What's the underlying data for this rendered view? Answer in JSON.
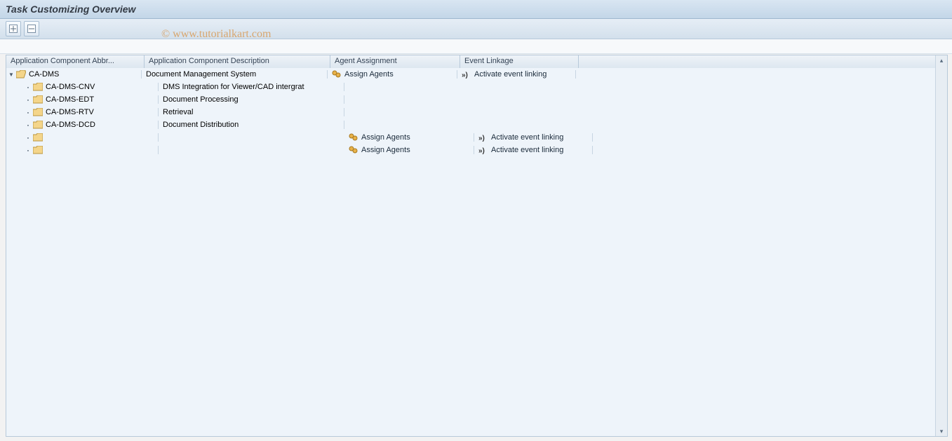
{
  "header": {
    "title": "Task Customizing Overview"
  },
  "watermark": "© www.tutorialkart.com",
  "toolbar": {
    "expand_all": "expand-all",
    "collapse_all": "collapse-all"
  },
  "columns": {
    "abbr": "Application Component Abbr...",
    "desc": "Application Component Description",
    "agent": "Agent Assignment",
    "event": "Event Linkage"
  },
  "tree": [
    {
      "level": 0,
      "expanded": true,
      "folder": "open",
      "abbr": "CA-DMS",
      "desc": "Document Management System",
      "agent": "Assign Agents",
      "event": "Activate event linking"
    },
    {
      "level": 1,
      "folder": "closed",
      "abbr": "CA-DMS-CNV",
      "desc": "DMS Integration for Viewer/CAD intergrat",
      "agent": "",
      "event": ""
    },
    {
      "level": 1,
      "folder": "closed",
      "abbr": "CA-DMS-EDT",
      "desc": "Document Processing",
      "agent": "",
      "event": ""
    },
    {
      "level": 1,
      "folder": "closed",
      "abbr": "CA-DMS-RTV",
      "desc": "Retrieval",
      "agent": "",
      "event": ""
    },
    {
      "level": 1,
      "folder": "closed",
      "abbr": "CA-DMS-DCD",
      "desc": "Document Distribution",
      "agent": "",
      "event": ""
    },
    {
      "level": 1,
      "folder": "closed",
      "abbr": "",
      "desc": "",
      "agent": "Assign Agents",
      "event": "Activate event linking"
    },
    {
      "level": 1,
      "folder": "closed",
      "abbr": "",
      "desc": "",
      "agent": "Assign Agents",
      "event": "Activate event linking"
    }
  ]
}
